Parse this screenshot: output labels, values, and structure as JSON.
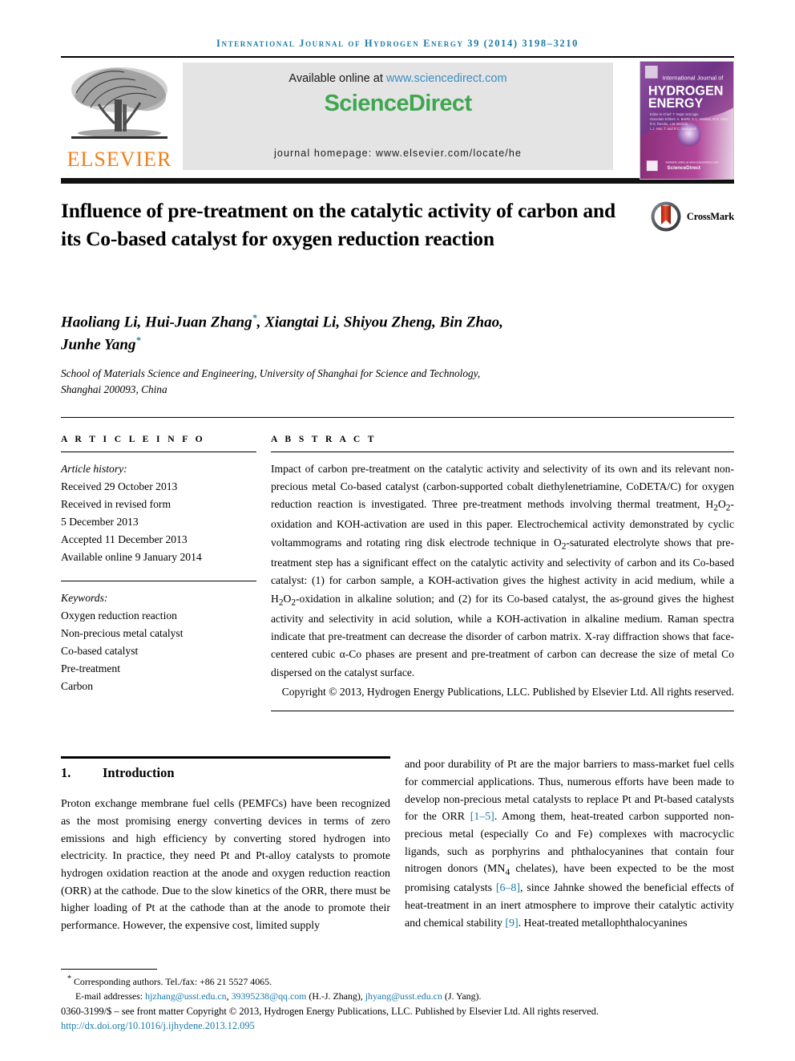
{
  "running_head": "International Journal of Hydrogen Energy 39 (2014) 3198–3210",
  "masthead": {
    "publisher_name": "ELSEVIER",
    "available_prefix": "Available online at ",
    "available_link": "www.sciencedirect.com",
    "sciencedirect_logo": "ScienceDirect",
    "journal_homepage": "journal homepage: www.elsevier.com/locate/he",
    "cover": {
      "kicker": "International Journal of",
      "line1": "HYDROGEN",
      "line2": "ENERGY",
      "footer_brand": "ScienceDirect"
    }
  },
  "article": {
    "title": "Influence of pre-treatment on the catalytic activity of carbon and its Co-based catalyst for oxygen reduction reaction",
    "crossmark_label": "CrossMark",
    "authors_line1": "Haoliang Li, Hui-Juan Zhang",
    "authors_line1_cont": ", Xiangtai Li, Shiyou Zheng, Bin Zhao,",
    "authors_line2": "Junhe Yang",
    "author_marker": "*",
    "affiliation_line1": "School of Materials Science and Engineering, University of Shanghai for Science and Technology,",
    "affiliation_line2": "Shanghai 200093, China"
  },
  "info": {
    "heading": "A R T I C L E   I N F O",
    "history_label": "Article history:",
    "history": [
      "Received 29 October 2013",
      "Received in revised form",
      "5 December 2013",
      "Accepted 11 December 2013",
      "Available online 9 January 2014"
    ],
    "keywords_label": "Keywords:",
    "keywords": [
      "Oxygen reduction reaction",
      "Non-precious metal catalyst",
      "Co-based catalyst",
      "Pre-treatment",
      "Carbon"
    ]
  },
  "abstract": {
    "heading": "A B S T R A C T",
    "body_part1": "Impact of carbon pre-treatment on the catalytic activity and selectivity of its own and its relevant non-precious metal Co-based catalyst (carbon-supported cobalt diethylenetriamine, CoDETA/C) for oxygen reduction reaction is investigated. Three pre-treatment methods involving thermal treatment, H",
    "h2o2_sub1": "2",
    "h2o2_mid": "O",
    "h2o2_sub2": "2",
    "body_part2": "-oxidation and KOH-activation are used in this paper. Electrochemical activity demonstrated by cyclic voltammograms and rotating ring disk electrode technique in O",
    "o2_sub": "2",
    "body_part3": "-saturated electrolyte shows that pre-treatment step has a significant effect on the catalytic activity and selectivity of carbon and its Co-based catalyst: (1) for carbon sample, a KOH-activation gives the highest activity in acid medium, while a H",
    "body_part4": "-oxidation in alkaline solution; and (2) for its Co-based catalyst, the as-ground gives the highest activity and selectivity in acid solution, while a KOH-activation in alkaline medium. Raman spectra indicate that pre-treatment can decrease the disorder of carbon matrix. X-ray diffraction shows that face-centered cubic α-Co phases are present and pre-treatment of carbon can decrease the size of metal Co dispersed on the catalyst surface.",
    "copyright": "Copyright © 2013, Hydrogen Energy Publications, LLC. Published by Elsevier Ltd. All rights reserved."
  },
  "body": {
    "section_number": "1.",
    "section_title": "Introduction",
    "left_paragraph": "Proton exchange membrane fuel cells (PEMFCs) have been recognized as the most promising energy converting devices in terms of zero emissions and high efficiency by converting stored hydrogen into electricity. In practice, they need Pt and Pt-alloy catalysts to promote hydrogen oxidation reaction at the anode and oxygen reduction reaction (ORR) at the cathode. Due to the slow kinetics of the ORR, there must be higher loading of Pt at the cathode than at the anode to promote their performance. However, the expensive cost, limited supply",
    "right_part1": "and poor durability of Pt are the major barriers to mass-market fuel cells for commercial applications. Thus, numerous efforts have been made to develop non-precious metal catalysts to replace Pt and Pt-based catalysts for the ORR ",
    "right_ref1": "[1–5]",
    "right_part2": ". Among them, heat-treated carbon supported non-precious metal (especially Co and Fe) complexes with macrocyclic ligands, such as porphyrins and phthalocyanines that contain four nitrogen donors (MN",
    "mn4_sub": "4",
    "right_part3": " chelates), have been expected to be the most promising catalysts ",
    "right_ref2": "[6–8]",
    "right_part4": ", since Jahnke showed the beneficial effects of heat-treatment in an inert atmosphere to improve their catalytic activity and chemical stability ",
    "right_ref3": "[9]",
    "right_part5": ". Heat-treated metallophthalocyanines"
  },
  "footer": {
    "corresponding_marker": "*",
    "corresponding": " Corresponding authors. Tel./fax: +86 21 5527 4065.",
    "email_label": "E-mail addresses: ",
    "email1": "hjzhang@usst.edu.cn",
    "email_sep1": ", ",
    "email2": "39395238@qq.com",
    "email_name1": " (H.-J. Zhang), ",
    "email3": "jhyang@usst.edu.cn",
    "email_name2": " (J. Yang).",
    "issn_line": "0360-3199/$ – see front matter Copyright © 2013, Hydrogen Energy Publications, LLC. Published by Elsevier Ltd. All rights reserved.",
    "doi": "http://dx.doi.org/10.1016/j.ijhydene.2013.12.095"
  },
  "colors": {
    "link": "#1a7aa8",
    "elsevier_orange": "#f07f1a",
    "sciencedirect_green": "#3fa650",
    "sd_link_blue": "#3a8fc4"
  }
}
